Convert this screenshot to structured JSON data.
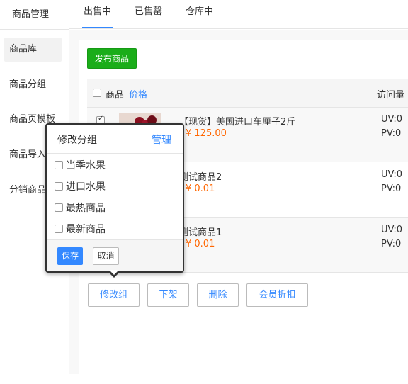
{
  "app": {
    "title": "商品管理"
  },
  "sidebar": {
    "items": [
      {
        "label": "商品库"
      },
      {
        "label": "商品分组"
      },
      {
        "label": "商品页模板"
      },
      {
        "label": "商品导入"
      },
      {
        "label": "分销商品"
      }
    ]
  },
  "tabs": [
    {
      "label": "出售中"
    },
    {
      "label": "已售罄"
    },
    {
      "label": "仓库中"
    }
  ],
  "toolbar": {
    "publish_label": "发布商品"
  },
  "table": {
    "header": {
      "product": "商品",
      "price": "价格",
      "visits": "访问量"
    },
    "rows": [
      {
        "title": "【现货】美国进口车厘子2斤",
        "price": "¥ 125.00",
        "uv": "UV:0",
        "pv": "PV:0",
        "checked": true
      },
      {
        "title": "测试商品2",
        "price": "¥ 0.01",
        "uv": "UV:0",
        "pv": "PV:0",
        "checked": false
      },
      {
        "title": "测试商品1",
        "price": "¥ 0.01",
        "uv": "UV:0",
        "pv": "PV:0",
        "checked": false
      }
    ]
  },
  "bulk_actions": [
    {
      "label": "修改组"
    },
    {
      "label": "下架"
    },
    {
      "label": "删除"
    },
    {
      "label": "会员折扣"
    }
  ],
  "popover": {
    "title": "修改分组",
    "manage": "管理",
    "options": [
      {
        "label": "当季水果"
      },
      {
        "label": "进口水果"
      },
      {
        "label": "最热商品"
      },
      {
        "label": "最新商品"
      }
    ],
    "save": "保存",
    "cancel": "取消"
  },
  "colors": {
    "accent": "#3388ff",
    "publish": "#1aad19",
    "price": "#ff6600"
  }
}
